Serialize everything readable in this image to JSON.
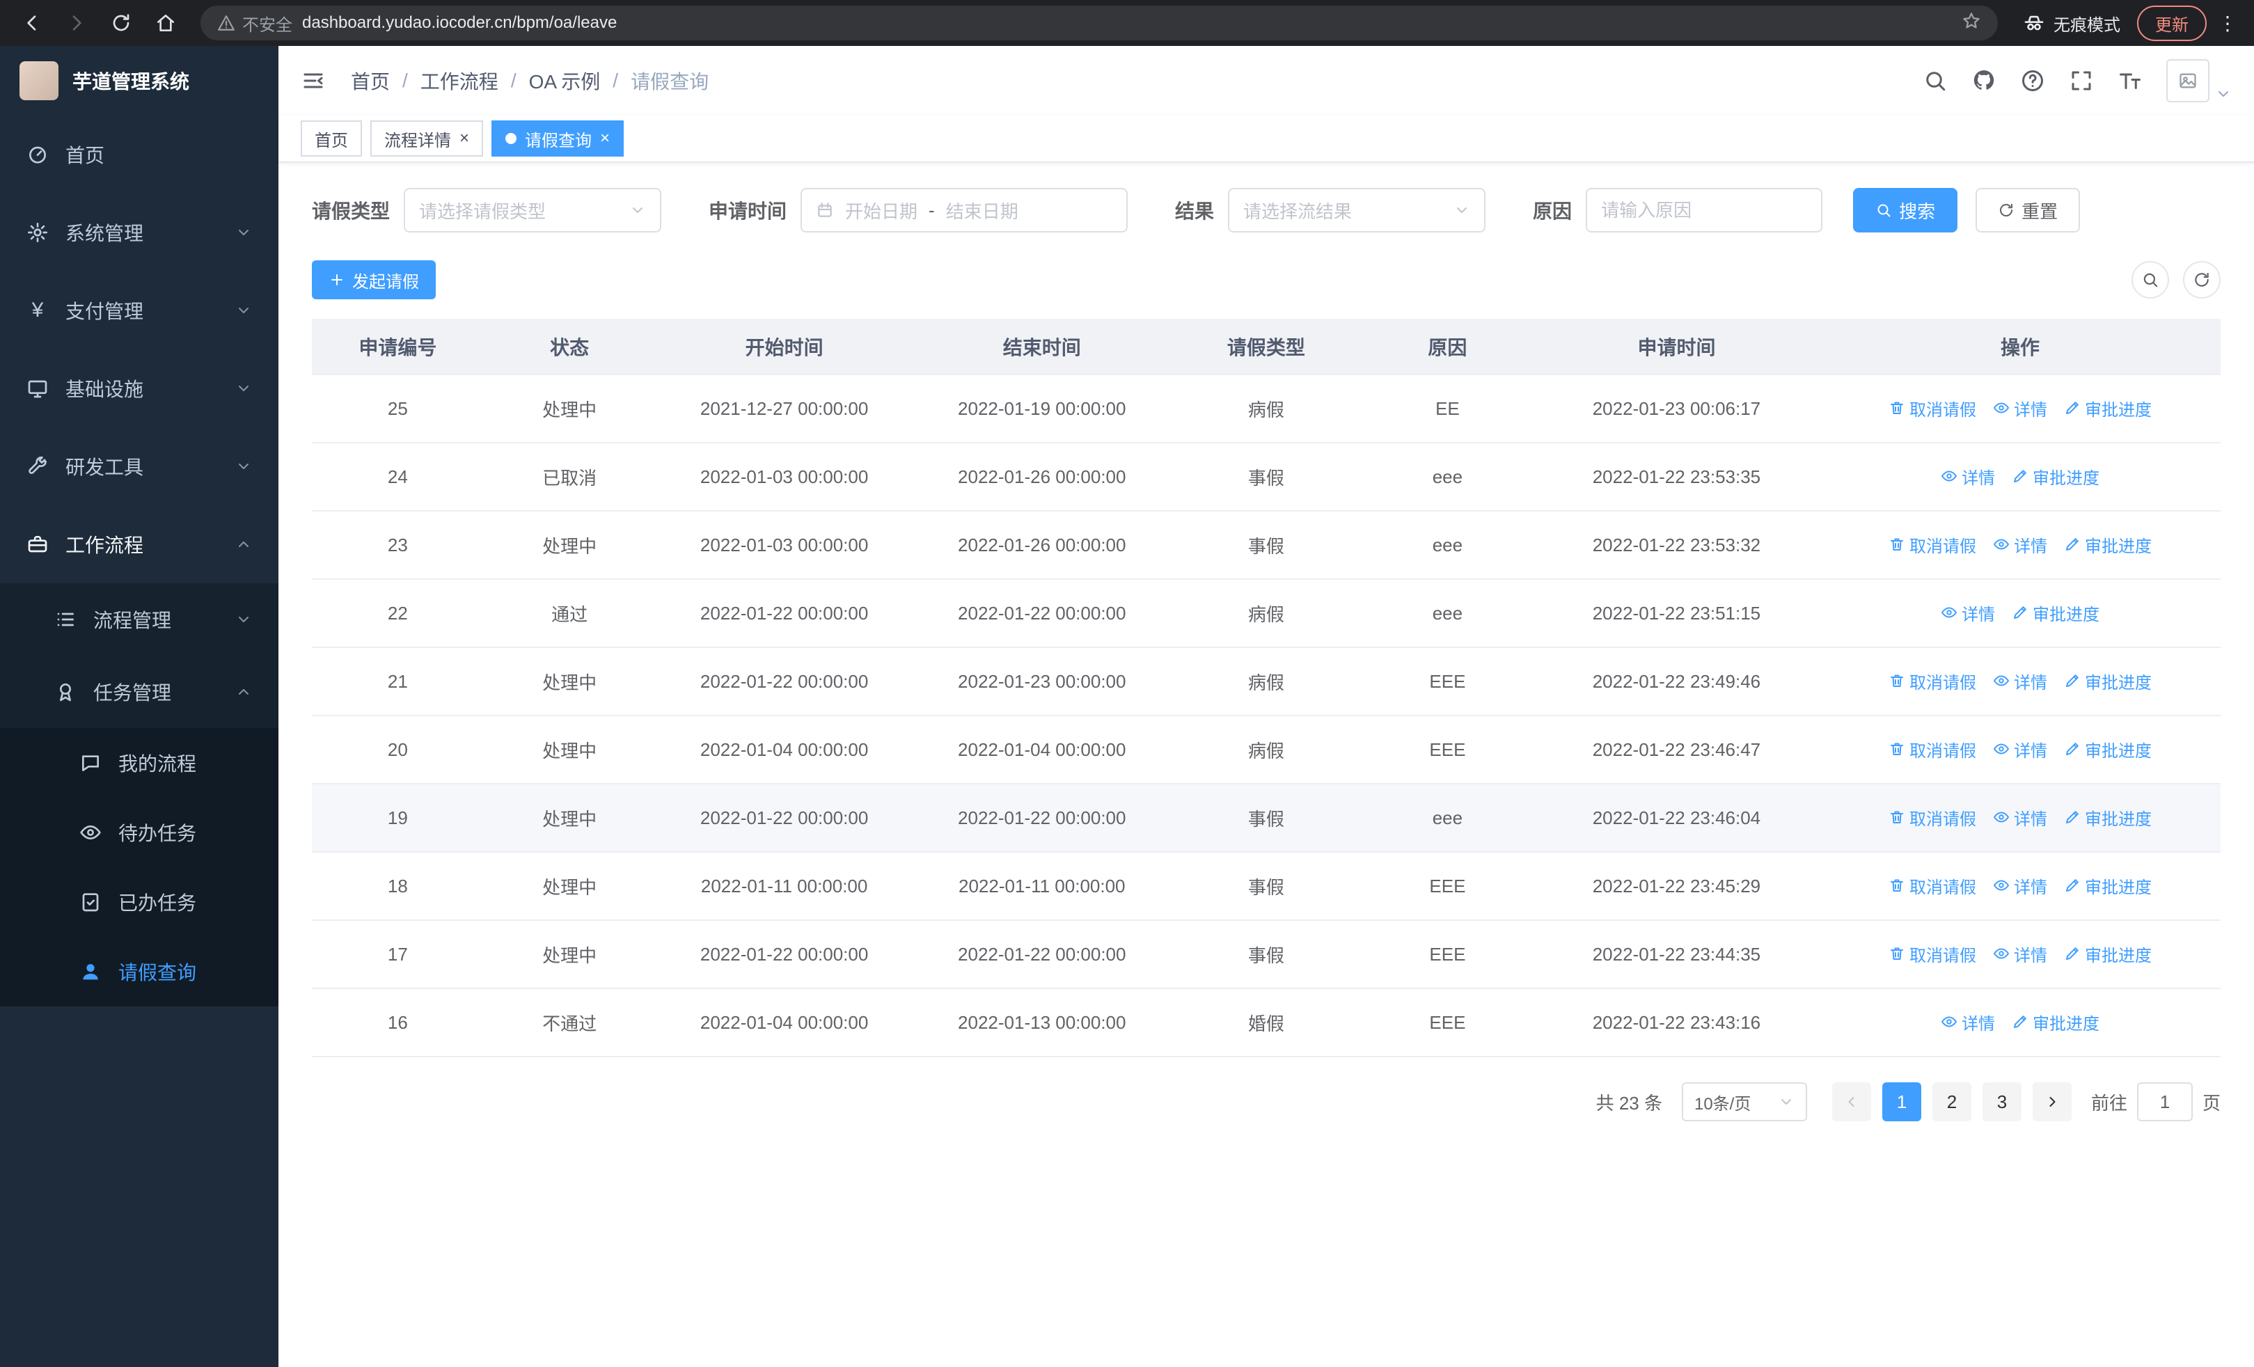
{
  "browser": {
    "security_label": "不安全",
    "url": "dashboard.yudao.iocoder.cn/bpm/oa/leave",
    "incognito_label": "无痕模式",
    "update_label": "更新"
  },
  "sidebar": {
    "app_title": "芋道管理系统",
    "items": [
      {
        "label": "首页"
      },
      {
        "label": "系统管理"
      },
      {
        "label": "支付管理"
      },
      {
        "label": "基础设施"
      },
      {
        "label": "研发工具"
      },
      {
        "label": "工作流程"
      },
      {
        "label": "流程管理"
      },
      {
        "label": "任务管理"
      },
      {
        "label": "我的流程"
      },
      {
        "label": "待办任务"
      },
      {
        "label": "已办任务"
      },
      {
        "label": "请假查询"
      }
    ]
  },
  "breadcrumb": {
    "separator": "/",
    "items": [
      "首页",
      "工作流程",
      "OA 示例",
      "请假查询"
    ]
  },
  "tabs": [
    {
      "label": "首页"
    },
    {
      "label": "流程详情"
    },
    {
      "label": "请假查询"
    }
  ],
  "filters": {
    "leave_type_label": "请假类型",
    "leave_type_placeholder": "请选择请假类型",
    "apply_time_label": "申请时间",
    "start_placeholder": "开始日期",
    "range_separator": "-",
    "end_placeholder": "结束日期",
    "result_label": "结果",
    "result_placeholder": "请选择流结果",
    "reason_label": "原因",
    "reason_placeholder": "请输入原因",
    "search_label": "搜索",
    "reset_label": "重置"
  },
  "toolbar": {
    "create_label": "发起请假"
  },
  "table": {
    "columns": [
      "申请编号",
      "状态",
      "开始时间",
      "结束时间",
      "请假类型",
      "原因",
      "申请时间",
      "操作"
    ],
    "action_labels": {
      "cancel": "取消请假",
      "detail": "详情",
      "progress": "审批进度"
    },
    "rows": [
      {
        "id": "25",
        "status": "处理中",
        "start": "2021-12-27 00:00:00",
        "end": "2022-01-19 00:00:00",
        "type": "病假",
        "reason": "EE",
        "applied": "2022-01-23 00:06:17",
        "actions": [
          "cancel",
          "detail",
          "progress"
        ]
      },
      {
        "id": "24",
        "status": "已取消",
        "start": "2022-01-03 00:00:00",
        "end": "2022-01-26 00:00:00",
        "type": "事假",
        "reason": "eee",
        "applied": "2022-01-22 23:53:35",
        "actions": [
          "detail",
          "progress"
        ]
      },
      {
        "id": "23",
        "status": "处理中",
        "start": "2022-01-03 00:00:00",
        "end": "2022-01-26 00:00:00",
        "type": "事假",
        "reason": "eee",
        "applied": "2022-01-22 23:53:32",
        "actions": [
          "cancel",
          "detail",
          "progress"
        ]
      },
      {
        "id": "22",
        "status": "通过",
        "start": "2022-01-22 00:00:00",
        "end": "2022-01-22 00:00:00",
        "type": "病假",
        "reason": "eee",
        "applied": "2022-01-22 23:51:15",
        "actions": [
          "detail",
          "progress"
        ]
      },
      {
        "id": "21",
        "status": "处理中",
        "start": "2022-01-22 00:00:00",
        "end": "2022-01-23 00:00:00",
        "type": "病假",
        "reason": "EEE",
        "applied": "2022-01-22 23:49:46",
        "actions": [
          "cancel",
          "detail",
          "progress"
        ]
      },
      {
        "id": "20",
        "status": "处理中",
        "start": "2022-01-04 00:00:00",
        "end": "2022-01-04 00:00:00",
        "type": "病假",
        "reason": "EEE",
        "applied": "2022-01-22 23:46:47",
        "actions": [
          "cancel",
          "detail",
          "progress"
        ]
      },
      {
        "id": "19",
        "status": "处理中",
        "start": "2022-01-22 00:00:00",
        "end": "2022-01-22 00:00:00",
        "type": "事假",
        "reason": "eee",
        "applied": "2022-01-22 23:46:04",
        "actions": [
          "cancel",
          "detail",
          "progress"
        ],
        "highlighted": true
      },
      {
        "id": "18",
        "status": "处理中",
        "start": "2022-01-11 00:00:00",
        "end": "2022-01-11 00:00:00",
        "type": "事假",
        "reason": "EEE",
        "applied": "2022-01-22 23:45:29",
        "actions": [
          "cancel",
          "detail",
          "progress"
        ]
      },
      {
        "id": "17",
        "status": "处理中",
        "start": "2022-01-22 00:00:00",
        "end": "2022-01-22 00:00:00",
        "type": "事假",
        "reason": "EEE",
        "applied": "2022-01-22 23:44:35",
        "actions": [
          "cancel",
          "detail",
          "progress"
        ]
      },
      {
        "id": "16",
        "status": "不通过",
        "start": "2022-01-04 00:00:00",
        "end": "2022-01-13 00:00:00",
        "type": "婚假",
        "reason": "EEE",
        "applied": "2022-01-22 23:43:16",
        "actions": [
          "detail",
          "progress"
        ]
      }
    ]
  },
  "pagination": {
    "total_label": "共 23 条",
    "page_size_value": "10条/页",
    "pages": [
      "1",
      "2",
      "3"
    ],
    "active_page": "1",
    "goto_label": "前往",
    "goto_value": "1",
    "goto_suffix": "页"
  },
  "colors": {
    "primary": "#409EFF",
    "sidebar_bg": "#1d2b3a",
    "update": "#f28b82"
  }
}
